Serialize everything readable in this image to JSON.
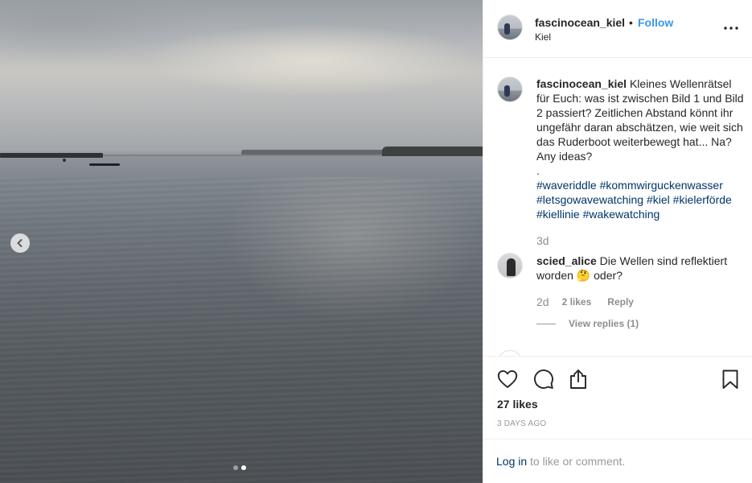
{
  "post": {
    "username": "fascinocean_kiel",
    "separator": "•",
    "follow_label": "Follow",
    "location": "Kiel"
  },
  "caption": {
    "username": "fascinocean_kiel",
    "text": "Kleines Wellenrätsel für Euch: was ist zwischen Bild 1 und Bild 2 passiert? Zeitlichen Abstand könnt ihr ungefähr daran abschätzen, wie weit sich das Ruderboot weiterbewegt hat... Na? Any ideas?",
    "dot": ".",
    "hashtags": "#waveriddle #kommwirguckenwasser #letsgowavewatching #kiel #kielerförde #kiellinie #wakewatching",
    "time": "3d"
  },
  "comment": {
    "username": "scied_alice",
    "text": "Die Wellen sind reflektiert worden 🤔 oder?",
    "time": "2d",
    "likes": "2 likes",
    "reply_label": "Reply",
    "view_replies": "View replies (1)"
  },
  "stats": {
    "likes": "27 likes",
    "date": "3 DAYS AGO"
  },
  "login": {
    "link": "Log in",
    "text": " to like or comment."
  },
  "carousel": {
    "slide_count": 2,
    "active_slide": 2
  },
  "icons": {
    "prev": "chevron-left-icon",
    "more": "more-horizontal-icon",
    "like": "heart-icon",
    "comment": "comment-bubble-icon",
    "share": "share-icon",
    "save": "bookmark-icon"
  },
  "colors": {
    "link_blue": "#3897f0",
    "hashtag": "#003569",
    "muted": "#8e8e8e"
  }
}
